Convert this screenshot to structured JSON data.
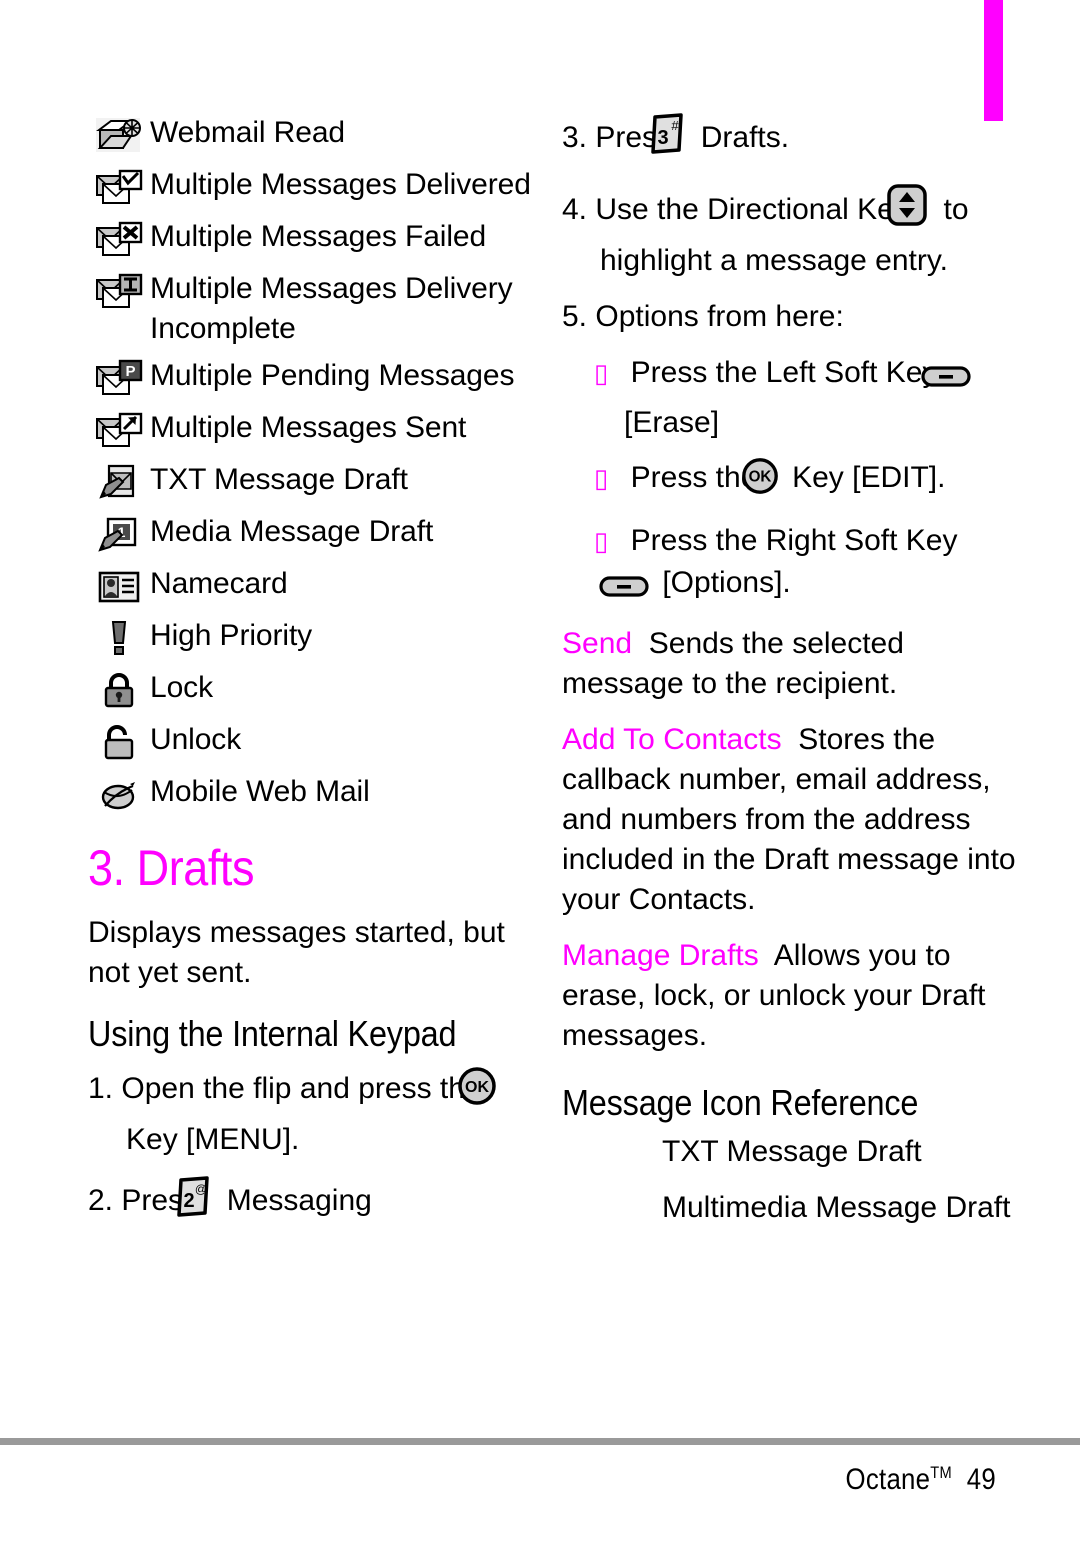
{
  "page": {
    "footer_brand": "Octane",
    "footer_tm": "TM",
    "footer_page_number": "49",
    "accent_color": "#ff00ff",
    "rule_color": "#9a9a9a"
  },
  "left_column": {
    "icon_reference_list": [
      {
        "icon": "webmail-read-icon",
        "label": "Webmail Read"
      },
      {
        "icon": "multiple-messages-delivered-icon",
        "label": "Multiple Messages Delivered"
      },
      {
        "icon": "multiple-messages-failed-icon",
        "label": "Multiple Messages Failed"
      },
      {
        "icon": "multiple-messages-delivery-incomplete-icon",
        "label": "Multiple Messages Delivery Incomplete"
      },
      {
        "icon": "multiple-pending-messages-icon",
        "label": "Multiple Pending Messages"
      },
      {
        "icon": "multiple-messages-sent-icon",
        "label": "Multiple Messages Sent"
      },
      {
        "icon": "txt-message-draft-icon",
        "label": "TXT Message Draft"
      },
      {
        "icon": "media-message-draft-icon",
        "label": "Media Message Draft"
      },
      {
        "icon": "namecard-icon",
        "label": "Namecard"
      },
      {
        "icon": "high-priority-icon",
        "label": "High Priority"
      },
      {
        "icon": "lock-icon",
        "label": "Lock"
      },
      {
        "icon": "unlock-icon",
        "label": "Unlock"
      },
      {
        "icon": "mobile-web-mail-icon",
        "label": "Mobile Web Mail"
      }
    ],
    "section_heading": "3. Drafts",
    "section_intro": "Displays messages started, but not yet sent.",
    "subheading": "Using the Internal Keypad",
    "steps": [
      {
        "number": "1.",
        "text_before": "Open the flip and press the",
        "key": "ok-key-icon",
        "text_after": "Key [MENU]."
      },
      {
        "number": "2.",
        "text_before": "Press",
        "key": "key-2-icon",
        "text_after": "Messaging"
      }
    ]
  },
  "right_column": {
    "steps": [
      {
        "number": "3.",
        "text_before": "Press",
        "key": "key-3-icon",
        "text_after": "Drafts."
      },
      {
        "number": "4.",
        "text_before": "Use the Directional Key",
        "key": "directional-key-icon",
        "text_after": "to highlight a message entry."
      },
      {
        "number": "5.",
        "text_before": "Options from here:",
        "key": "",
        "text_after": ""
      }
    ],
    "bullets": [
      {
        "text_before": "Press the Left Soft Key",
        "key": "left-soft-key-icon",
        "text_after": "[Erase]"
      },
      {
        "text_before": "Press the",
        "key": "ok-key-icon",
        "text_after": "Key [EDIT]."
      },
      {
        "text_before": "Press the Right Soft Key",
        "key": "right-soft-key-icon",
        "text_after": "[Options]."
      }
    ],
    "options": [
      {
        "name": "Send",
        "description": "Sends the selected message to the recipient."
      },
      {
        "name": "Add To Contacts",
        "description": "Stores the callback number, email address, and numbers from the address included in the Draft message into your Contacts."
      },
      {
        "name": "Manage Drafts",
        "description": "Allows you to erase, lock, or unlock your Draft messages."
      }
    ],
    "reference_heading": "Message Icon Reference",
    "reference_items": [
      {
        "icon": "txt-message-draft-icon",
        "label": "TXT Message Draft"
      },
      {
        "icon": "multimedia-message-draft-icon",
        "label": "Multimedia Message Draft"
      }
    ]
  }
}
